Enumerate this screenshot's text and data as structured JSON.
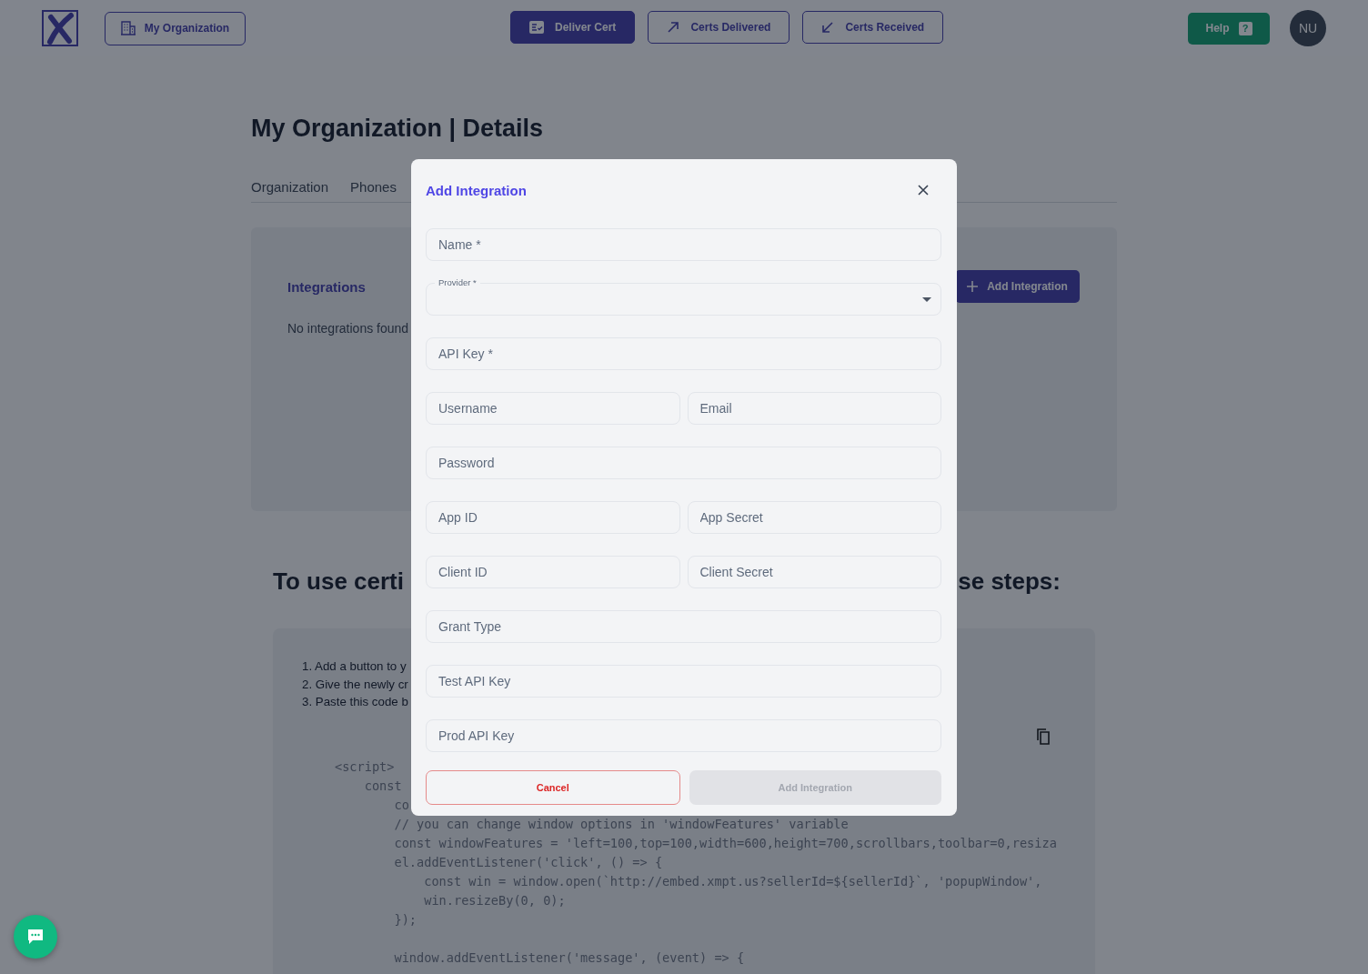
{
  "header": {
    "org_button": "My Organization",
    "nav": [
      {
        "label": "Deliver Cert",
        "kind": "deliver",
        "selected": true
      },
      {
        "label": "Certs Delivered",
        "kind": "out",
        "selected": false
      },
      {
        "label": "Certs Received",
        "kind": "in",
        "selected": false
      }
    ],
    "help": "Help",
    "help_mark": "?",
    "avatar": "NU"
  },
  "page": {
    "title": "My Organization | Details",
    "tabs": [
      {
        "label": "Organization",
        "selected": false
      },
      {
        "label": "Phones",
        "selected": false
      }
    ],
    "integrations": {
      "title": "Integrations",
      "empty": "No integrations found",
      "add_button": "Add Integration"
    },
    "guide": {
      "heading_left": "To use certi",
      "heading_right": "se steps:",
      "steps": [
        "1. Add a button to y",
        "2. Give the newly cr",
        "3. Paste this code b"
      ],
      "code": [
        [
          "<script>",
          "    const",
          "        co",
          "        // you can change window options in 'windowFeatures' variable",
          "        const windowFeatures = 'left=100,top=100,width=600,height=700,scrollbars,toolbar=0,resiza",
          "        el.addEventListener('click', () => {",
          "            const win = window.open(`http://embed.xmpt.us?sellerId=${sellerId}`, 'popupWindow',",
          "            win.resizeBy(0, 0);",
          "        });"
        ],
        [
          "        window.addEventListener('message', (event) => {"
        ]
      ]
    }
  },
  "modal": {
    "title": "Add Integration",
    "rows": [
      [
        {
          "kind": "text",
          "placeholder": "Name *"
        }
      ],
      [
        {
          "kind": "select",
          "label": "Provider *"
        }
      ],
      [
        {
          "kind": "text",
          "placeholder": "API Key *"
        }
      ],
      [
        {
          "kind": "text",
          "placeholder": "Username"
        },
        {
          "kind": "text",
          "placeholder": "Email"
        }
      ],
      [
        {
          "kind": "text",
          "placeholder": "Password"
        }
      ],
      [
        {
          "kind": "text",
          "placeholder": "App ID"
        },
        {
          "kind": "text",
          "placeholder": "App Secret"
        }
      ],
      [
        {
          "kind": "text",
          "placeholder": "Client ID"
        },
        {
          "kind": "text",
          "placeholder": "Client Secret"
        }
      ],
      [
        {
          "kind": "text",
          "placeholder": "Grant Type"
        }
      ],
      [
        {
          "kind": "text",
          "placeholder": "Test API Key"
        }
      ],
      [
        {
          "kind": "text",
          "placeholder": "Prod API Key"
        }
      ]
    ],
    "cancel": "Cancel",
    "submit": {
      "label": "Add Integration",
      "disabled": true
    }
  }
}
